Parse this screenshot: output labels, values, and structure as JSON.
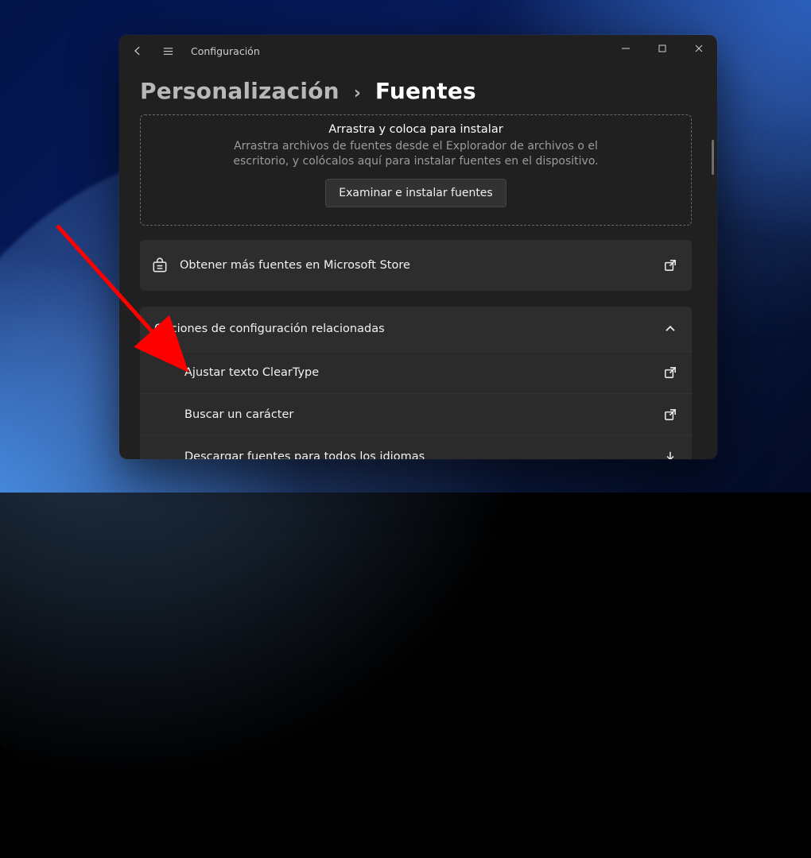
{
  "window": {
    "app_title": "Configuración"
  },
  "breadcrumb": {
    "parent": "Personalización",
    "separator": "›",
    "page": "Fuentes"
  },
  "drop_area": {
    "title": "Arrastra y coloca para instalar",
    "description": "Arrastra archivos de fuentes desde el Explorador de archivos o el escritorio, y colócalos aquí para instalar fuentes en el dispositivo.",
    "browse_button": "Examinar e instalar fuentes"
  },
  "store_tile": {
    "label": "Obtener más fuentes en Microsoft Store"
  },
  "related_group": {
    "header": "Opciones de configuración relacionadas",
    "items": [
      {
        "label": "Ajustar texto ClearType",
        "trail": "open-external"
      },
      {
        "label": "Buscar un carácter",
        "trail": "open-external"
      },
      {
        "label": "Descargar fuentes para todos los idiomas",
        "trail": "download"
      }
    ]
  },
  "annotation": {
    "arrow_color": "#ff0000"
  }
}
